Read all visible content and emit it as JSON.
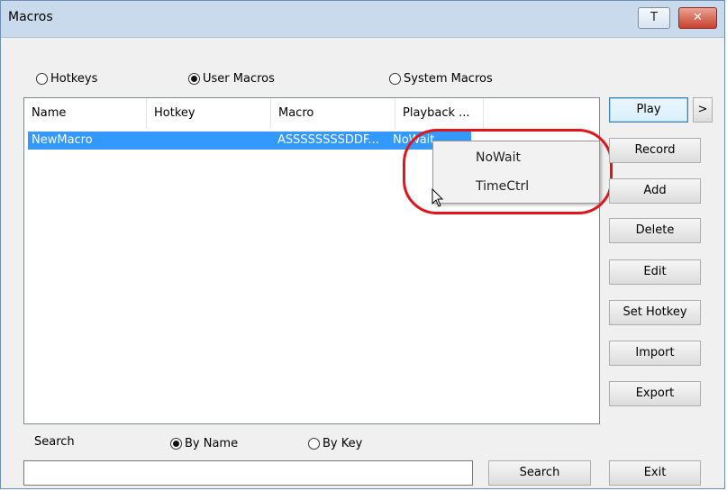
{
  "window": {
    "title": "Macros",
    "pin_glyph": "T",
    "close_glyph": "✕"
  },
  "mode_radios": [
    {
      "label": "Hotkeys",
      "checked": false
    },
    {
      "label": "User Macros",
      "checked": true
    },
    {
      "label": "System Macros",
      "checked": false
    }
  ],
  "list": {
    "columns": [
      "Name",
      "Hotkey",
      "Macro",
      "Playback ..."
    ],
    "rows": [
      {
        "name": "NewMacro",
        "hotkey": "",
        "macro": "ASSSSSSSSDDF...",
        "playback": "NoWait",
        "selected": true
      }
    ]
  },
  "context_menu": {
    "items": [
      "NoWait",
      "TimeCtrl"
    ]
  },
  "buttons": {
    "play": "Play",
    "more": ">",
    "record": "Record",
    "add": "Add",
    "delete": "Delete",
    "edit": "Edit",
    "set_hotkey": "Set Hotkey",
    "import": "Import",
    "export": "Export",
    "search": "Search",
    "exit": "Exit"
  },
  "search": {
    "label": "Search",
    "value": "",
    "by_radios": [
      {
        "label": "By Name",
        "checked": true
      },
      {
        "label": "By Key",
        "checked": false
      }
    ]
  },
  "colors": {
    "selection": "#3399ff",
    "highlight_ring": "#e1141a",
    "close_button": "#c8412d"
  }
}
